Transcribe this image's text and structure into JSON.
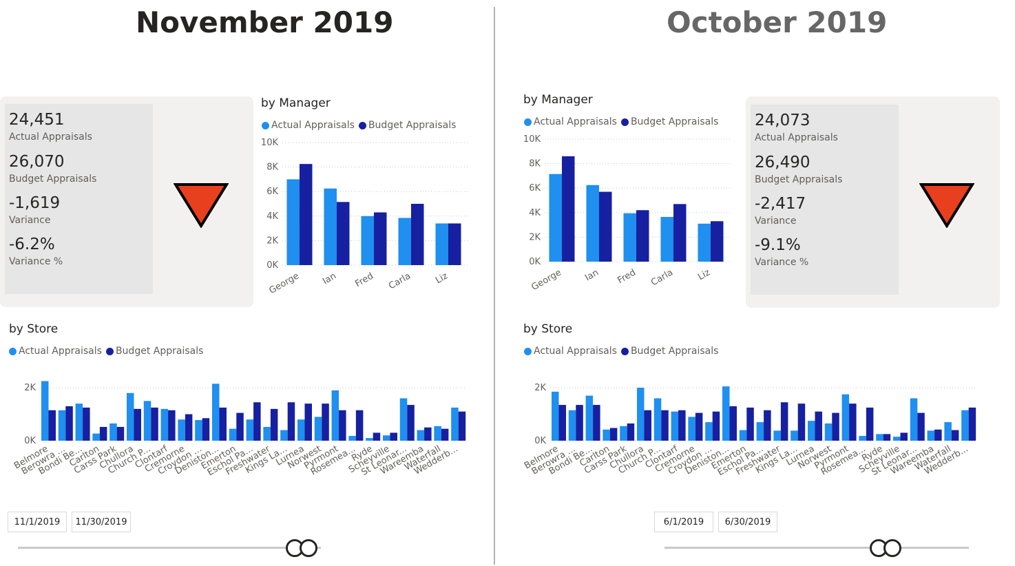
{
  "colors": {
    "actual": "#1f8ff0",
    "budget": "#1720a0",
    "triangle": "#e8401f"
  },
  "panels": [
    {
      "title": "November 2019",
      "kpi": {
        "actual_value": "24,451",
        "actual_label": "Actual Appraisals",
        "budget_value": "26,070",
        "budget_label": "Budget Appraisals",
        "variance_value": "-1,619",
        "variance_label": "Variance",
        "variance_pct_value": "-6.2%",
        "variance_pct_label": "Variance %",
        "indicator": "down-triangle-icon"
      },
      "manager_title": "by Manager",
      "store_title": "by Store",
      "legend": {
        "actual": "Actual Appraisals",
        "budget": "Budget Appraisals"
      },
      "date_start": "11/1/2019",
      "date_end": "11/30/2019",
      "slider_position": 0.93
    },
    {
      "title": "October 2019",
      "kpi": {
        "actual_value": "24,073",
        "actual_label": "Actual Appraisals",
        "budget_value": "26,490",
        "budget_label": "Budget Appraisals",
        "variance_value": "-2,417",
        "variance_label": "Variance",
        "variance_pct_value": "-9.1%",
        "variance_pct_label": "Variance %",
        "indicator": "down-triangle-icon"
      },
      "manager_title": "by Manager",
      "store_title": "by Store",
      "legend": {
        "actual": "Actual Appraisals",
        "budget": "Budget Appraisals"
      },
      "date_start": "6/1/2019",
      "date_end": "6/30/2019",
      "slider_position": 0.72
    }
  ],
  "chart_data": [
    {
      "type": "bar",
      "chart": "by Manager",
      "panel": "November 2019",
      "categories": [
        "George",
        "Ian",
        "Fred",
        "Carla",
        "Liz"
      ],
      "series": [
        {
          "name": "Actual Appraisals",
          "values": [
            7000,
            6250,
            4000,
            3850,
            3400
          ]
        },
        {
          "name": "Budget Appraisals",
          "values": [
            8250,
            5150,
            4300,
            5000,
            3400
          ]
        }
      ],
      "yticks": [
        "0K",
        "2K",
        "4K",
        "6K",
        "8K",
        "10K"
      ],
      "ylim": [
        0,
        10000
      ]
    },
    {
      "type": "bar",
      "chart": "by Store",
      "panel": "November 2019",
      "categories": [
        "Belmore",
        "Berowra ...",
        "Bondi Be...",
        "Carlton",
        "Carss Park",
        "Chullora",
        "Church P...",
        "Clontarf",
        "Cremorne",
        "Croydon ...",
        "Deniston...",
        "Emerton",
        "Eschol Pa...",
        "Freshwater",
        "Kings La...",
        "Lurnea",
        "Norwest",
        "Pyrmont",
        "Rosemea...",
        "Ryde",
        "Scheyville",
        "St Leonar...",
        "Wareemba",
        "Waterfall",
        "Wedderb..."
      ],
      "series": [
        {
          "name": "Actual Appraisals",
          "values": [
            2250,
            1150,
            1400,
            270,
            650,
            1800,
            1500,
            1200,
            800,
            780,
            2150,
            450,
            800,
            520,
            400,
            800,
            900,
            1900,
            180,
            100,
            200,
            1600,
            400,
            550,
            1250
          ]
        },
        {
          "name": "Budget Appraisals",
          "values": [
            1150,
            1300,
            1250,
            520,
            520,
            1200,
            1250,
            1150,
            1000,
            850,
            1250,
            1050,
            1450,
            1200,
            1450,
            1400,
            1400,
            1150,
            1150,
            300,
            300,
            1350,
            500,
            450,
            1100
          ]
        }
      ],
      "yticks": [
        "0K",
        "2K"
      ],
      "ylim": [
        0,
        2600
      ]
    },
    {
      "type": "bar",
      "chart": "by Manager",
      "panel": "October 2019",
      "categories": [
        "George",
        "Ian",
        "Fred",
        "Carla",
        "Liz"
      ],
      "series": [
        {
          "name": "Actual Appraisals",
          "values": [
            7150,
            6250,
            3950,
            3650,
            3100
          ]
        },
        {
          "name": "Budget Appraisals",
          "values": [
            8600,
            5700,
            4200,
            4700,
            3300
          ]
        }
      ],
      "yticks": [
        "0K",
        "2K",
        "4K",
        "6K",
        "8K",
        "10K"
      ],
      "ylim": [
        0,
        10000
      ]
    },
    {
      "type": "bar",
      "chart": "by Store",
      "panel": "October 2019",
      "categories": [
        "Belmore",
        "Berowra ...",
        "Bondi Be...",
        "Carlton",
        "Carss Park",
        "Chullora",
        "Church P...",
        "Clontarf",
        "Cremorne",
        "Croydon ...",
        "Deniston...",
        "Emerton",
        "Eschol Pa...",
        "Freshwater",
        "Kings La...",
        "Lurnea",
        "Norwest",
        "Pyrmont",
        "Rosemea...",
        "Ryde",
        "Scheyville",
        "St Leonar...",
        "Wareemba",
        "Waterfall",
        "Wedderb..."
      ],
      "series": [
        {
          "name": "Actual Appraisals",
          "values": [
            1850,
            1150,
            1700,
            420,
            550,
            2000,
            1600,
            1100,
            900,
            700,
            2050,
            400,
            700,
            380,
            380,
            750,
            650,
            1750,
            180,
            250,
            150,
            1600,
            380,
            700,
            1150
          ]
        },
        {
          "name": "Budget Appraisals",
          "values": [
            1350,
            1350,
            1350,
            480,
            650,
            1150,
            1150,
            1150,
            1050,
            1100,
            1300,
            1250,
            1150,
            1450,
            1400,
            1100,
            1050,
            1400,
            1250,
            250,
            300,
            1050,
            420,
            400,
            1250
          ]
        }
      ],
      "yticks": [
        "0K",
        "2K"
      ],
      "ylim": [
        0,
        2600
      ]
    }
  ]
}
